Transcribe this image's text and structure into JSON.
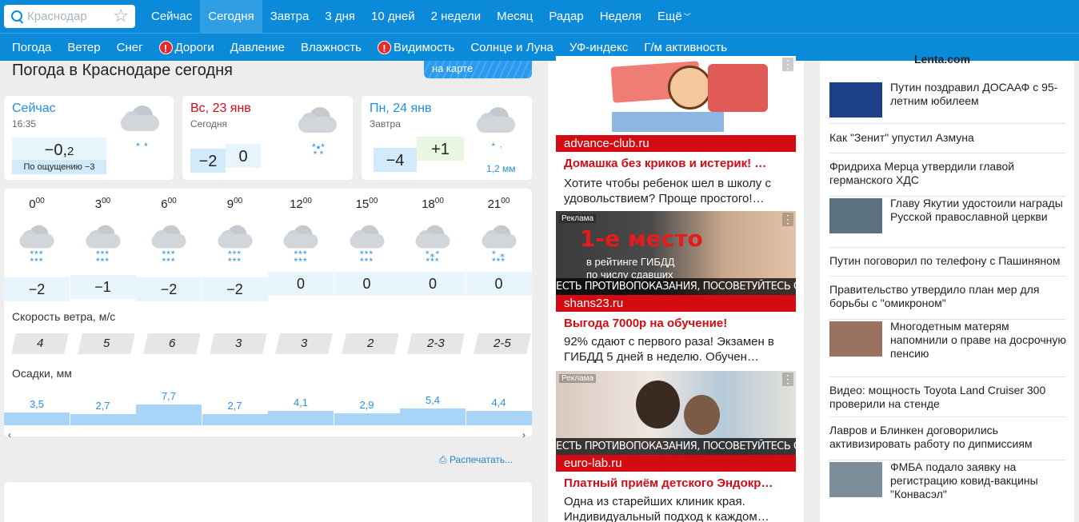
{
  "search": {
    "placeholder": "Краснодар"
  },
  "tabs": [
    {
      "label": "Сейчас"
    },
    {
      "label": "Сегодня"
    },
    {
      "label": "Завтра"
    },
    {
      "label": "3 дня"
    },
    {
      "label": "10 дней"
    },
    {
      "label": "2 недели"
    },
    {
      "label": "Месяц"
    },
    {
      "label": "Радар"
    },
    {
      "label": "Неделя"
    },
    {
      "label": "Ещё"
    }
  ],
  "subnav": [
    {
      "label": "Погода"
    },
    {
      "label": "Ветер"
    },
    {
      "label": "Снег"
    },
    {
      "label": "Дороги",
      "warning": "!"
    },
    {
      "label": "Давление"
    },
    {
      "label": "Влажность"
    },
    {
      "label": "Видимость",
      "warning": "!"
    },
    {
      "label": "Солнце и Луна"
    },
    {
      "label": "УФ-индекс"
    },
    {
      "label": "Г/м активность"
    }
  ],
  "page_title": "Погода в Краснодаре сегодня",
  "map_button": "на карте",
  "now": {
    "title": "Сейчас",
    "time": "16:35",
    "temp_main": "−0,",
    "temp_frac": "2",
    "feels": "По ощущению −3"
  },
  "today": {
    "title": "Вс, 23 янв",
    "sub": "Сегодня",
    "tmin": "−2",
    "tmax": "0"
  },
  "tomorrow": {
    "title": "Пн, 24 янв",
    "sub": "Завтра",
    "tmin": "−4",
    "tmax": "+1",
    "precip": "1,2 мм"
  },
  "hourly": {
    "hours": [
      "0",
      "3",
      "6",
      "9",
      "12",
      "15",
      "18",
      "21"
    ],
    "minutes": "00",
    "temps": [
      "−2",
      "−1",
      "−2",
      "−2",
      "0",
      "0",
      "0",
      "0"
    ],
    "wind_label": "Скорость ветра, м/с",
    "wind": [
      "4",
      "5",
      "6",
      "3",
      "3",
      "2",
      "2-3",
      "2-5"
    ],
    "precip_label": "Осадки, мм",
    "precip": [
      "3,5",
      "2,7",
      "7,7",
      "2,7",
      "4,1",
      "2,9",
      "5,4",
      "4,4"
    ],
    "precip_values": [
      3.5,
      2.7,
      7.7,
      2.7,
      4.1,
      2.9,
      5.4,
      4.4
    ]
  },
  "print_label": "Распечатать...",
  "ads": [
    {
      "domain": "advance-club.ru",
      "title": "Домашка без криков и истерик! …",
      "text": "Хотите чтобы ребенок шел в школу с удовольствием? Проще простого!…",
      "label": ""
    },
    {
      "domain": "shans23.ru",
      "title": "Выгода 7000р на обучение!",
      "text": "92% сдают с первого раза! Экзамен в ГИБДД 5 дней в неделю. Обучен…",
      "label": "Реклама",
      "banner_big": "1-е место",
      "banner_small": "в рейтинге ГИБДД",
      "banner_small2": "по числу сдавших",
      "warning": "ЕСТЬ ПРОТИВОПОКАЗАНИЯ, ПОСОВЕТУЙТЕСЬ С ВРАЧОМ"
    },
    {
      "domain": "euro-lab.ru",
      "title": "Платный приём детского Эндокр…",
      "text": "Одна из старейших клиник края. Индивидуальный подход к каждом…",
      "label": "Реклама",
      "warning": "ЕСТЬ ПРОТИВОПОКАЗАНИЯ, ПОСОВЕТУЙТЕСЬ С ВРАЧОМ"
    }
  ],
  "news": {
    "header": "Lenta.com",
    "items": [
      {
        "text": "Путин поздравил ДОСААФ с 95-летним юбилеем",
        "thumb": true
      },
      {
        "text": "Как \"Зенит\" упустил Азмуна",
        "thumb": false
      },
      {
        "text": "Фридриха Мерца утвердили главой германского ХДС",
        "thumb": false
      },
      {
        "text": "Главу Якутии удостоили награды Русской православной церкви",
        "thumb": true
      },
      {
        "text": "Путин поговорил по телефону с Пашиняном",
        "thumb": false
      },
      {
        "text": "Правительство утвердило план мер для борьбы с \"омикроном\"",
        "thumb": false
      },
      {
        "text": "Многодетным матерям напомнили о праве на досрочную пенсию",
        "thumb": true
      },
      {
        "text": "Видео: мощность Toyota Land Cruiser 300 проверили на стенде",
        "thumb": false
      },
      {
        "text": "Лавров и Блинкен договорились активизировать работу по дипмиссиям",
        "thumb": false
      },
      {
        "text": "ФМБА подало заявку на регистрацию ковид-вакцины \"Конвасэл\"",
        "thumb": true
      }
    ]
  },
  "colors": {
    "brand": "#0a8ad8",
    "ad_red": "#d40b12",
    "snow": "#2b8fe3"
  }
}
